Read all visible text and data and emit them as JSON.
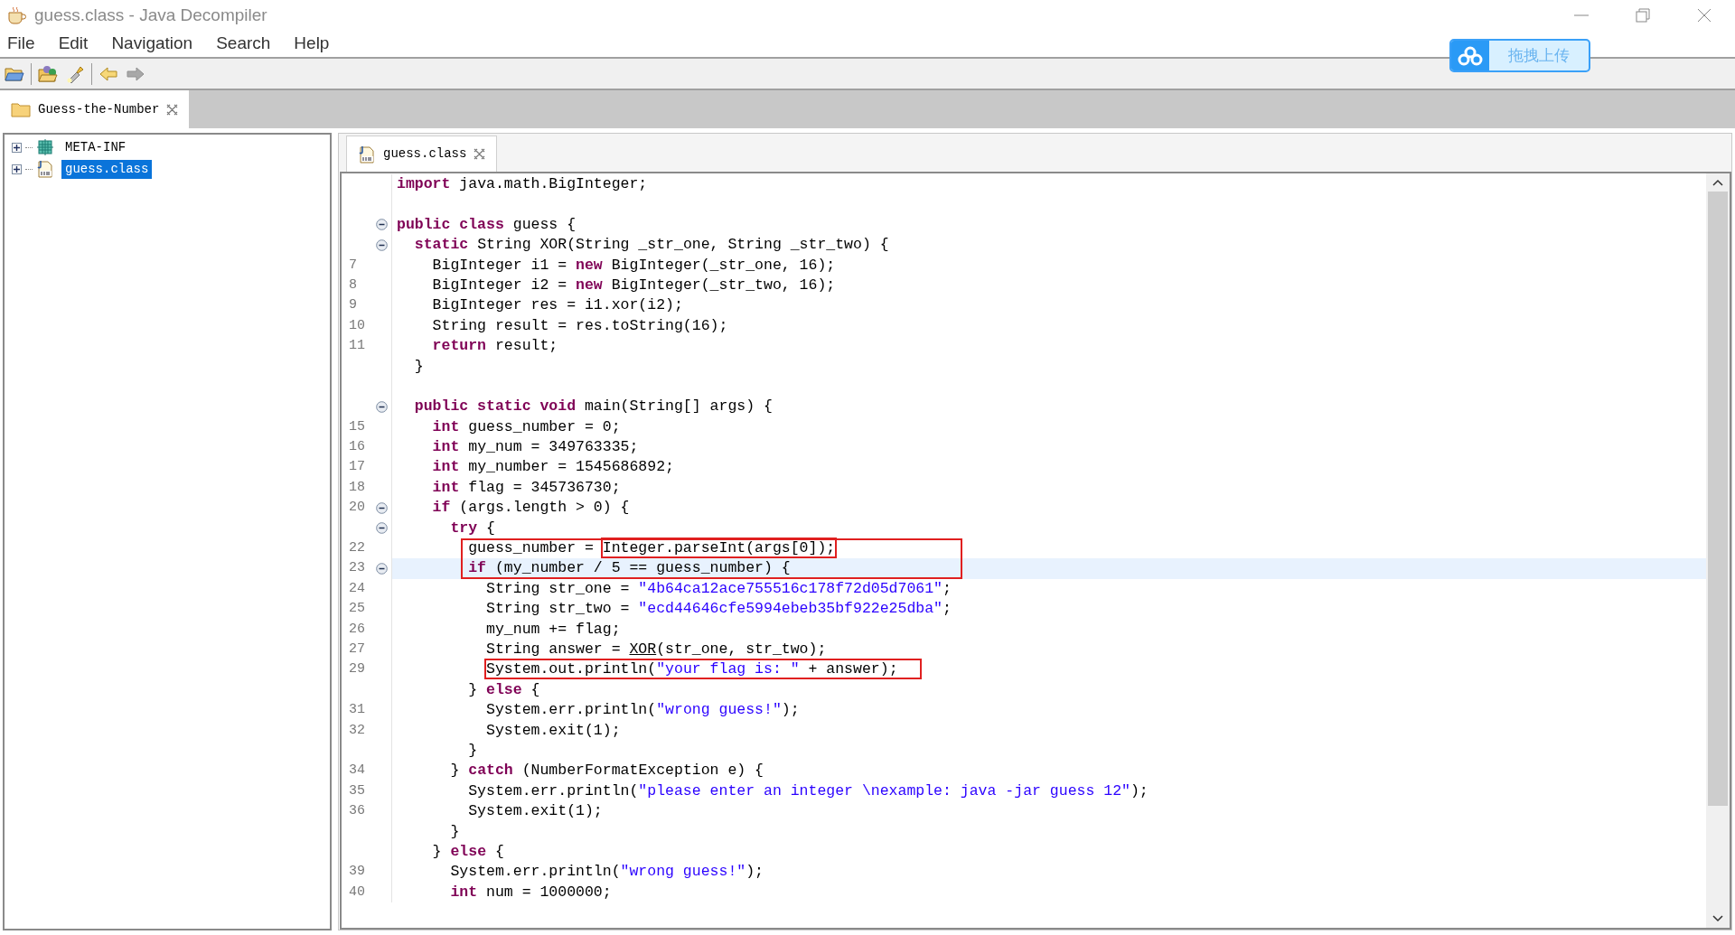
{
  "window": {
    "title": "guess.class - Java Decompiler"
  },
  "menu": [
    "File",
    "Edit",
    "Navigation",
    "Search",
    "Help"
  ],
  "toolbar": [
    {
      "kind": "open"
    },
    {
      "kind": "open-type"
    },
    {
      "kind": "search"
    },
    {
      "kind": "back",
      "disabled": false
    },
    {
      "kind": "forward",
      "disabled": true
    }
  ],
  "upload_button": {
    "label": "拖拽上传"
  },
  "project_tabs": [
    {
      "label": "Guess-the-Number",
      "selected": true
    }
  ],
  "tree": [
    {
      "label": "META-INF",
      "kind": "package",
      "expanded": false,
      "selected": false
    },
    {
      "label": "guess.class",
      "kind": "class",
      "expanded": false,
      "selected": true
    }
  ],
  "editor_tabs": [
    {
      "label": "guess.class",
      "selected": true
    }
  ],
  "code": {
    "lines": [
      {
        "tokens": [
          {
            "t": "import",
            "kind": "keyword"
          },
          {
            "t": " java.math.BigInteger;",
            "kind": "plain"
          }
        ]
      },
      {
        "kind": "blank"
      },
      {
        "fold": true,
        "tokens": [
          {
            "t": "public class",
            "kind": "keyword"
          },
          {
            "t": " guess {",
            "kind": "plain"
          }
        ]
      },
      {
        "fold": true,
        "tokens": [
          {
            "t": "  static",
            "kind": "keyword"
          },
          {
            "t": " String XOR(String _str_one, String _str_two) {",
            "kind": "plain"
          }
        ]
      },
      {
        "number": "7",
        "tokens": [
          {
            "t": "    BigInteger i1 = ",
            "kind": "plain"
          },
          {
            "t": "new",
            "kind": "keyword"
          },
          {
            "t": " BigInteger(_str_one, 16);",
            "kind": "plain"
          }
        ]
      },
      {
        "number": "8",
        "tokens": [
          {
            "t": "    BigInteger i2 = ",
            "kind": "plain"
          },
          {
            "t": "new",
            "kind": "keyword"
          },
          {
            "t": " BigInteger(_str_two, 16);",
            "kind": "plain"
          }
        ]
      },
      {
        "number": "9",
        "tokens": [
          {
            "t": "    BigInteger res = i1.xor(i2);",
            "kind": "plain"
          }
        ]
      },
      {
        "number": "10",
        "tokens": [
          {
            "t": "    String result = res.toString(16);",
            "kind": "plain"
          }
        ]
      },
      {
        "number": "11",
        "tokens": [
          {
            "t": "    return",
            "kind": "keyword"
          },
          {
            "t": " result;",
            "kind": "plain"
          }
        ]
      },
      {
        "tokens": [
          {
            "t": "  }",
            "kind": "plain"
          }
        ]
      },
      {
        "kind": "blank"
      },
      {
        "fold": true,
        "tokens": [
          {
            "t": "  public static void",
            "kind": "keyword"
          },
          {
            "t": " main(String[] args) {",
            "kind": "plain"
          }
        ]
      },
      {
        "number": "15",
        "tokens": [
          {
            "t": "    int",
            "kind": "keyword"
          },
          {
            "t": " guess_number = 0;",
            "kind": "plain"
          }
        ]
      },
      {
        "number": "16",
        "tokens": [
          {
            "t": "    int",
            "kind": "keyword"
          },
          {
            "t": " my_num = 349763335;",
            "kind": "plain"
          }
        ]
      },
      {
        "number": "17",
        "tokens": [
          {
            "t": "    int",
            "kind": "keyword"
          },
          {
            "t": " my_number = 1545686892;",
            "kind": "plain"
          }
        ]
      },
      {
        "number": "18",
        "tokens": [
          {
            "t": "    int",
            "kind": "keyword"
          },
          {
            "t": " flag = 345736730;",
            "kind": "plain"
          }
        ]
      },
      {
        "number": "20",
        "fold": true,
        "tokens": [
          {
            "t": "    if",
            "kind": "keyword"
          },
          {
            "t": " (args.length > 0) {",
            "kind": "plain"
          }
        ]
      },
      {
        "fold": true,
        "tokens": [
          {
            "t": "      try",
            "kind": "keyword"
          },
          {
            "t": " {",
            "kind": "plain"
          }
        ]
      },
      {
        "number": "22",
        "framed": true,
        "tokens": [
          {
            "t": "        guess_number = ",
            "kind": "plain"
          },
          {
            "t": "Integer.parseInt(args[0]);",
            "kind": "plain",
            "boxed": true
          }
        ]
      },
      {
        "number": "23",
        "fold": true,
        "highlighted": true,
        "framed": true,
        "tokens": [
          {
            "t": "        if",
            "kind": "keyword"
          },
          {
            "t": " (my_number / 5 == guess_number) {",
            "kind": "plain"
          }
        ]
      },
      {
        "number": "24",
        "tokens": [
          {
            "t": "          String str_one = ",
            "kind": "plain"
          },
          {
            "t": "\"4b64ca12ace755516c178f72d05d7061\"",
            "kind": "string"
          },
          {
            "t": ";",
            "kind": "plain"
          }
        ]
      },
      {
        "number": "25",
        "tokens": [
          {
            "t": "          String str_two = ",
            "kind": "plain"
          },
          {
            "t": "\"ecd44646cfe5994ebeb35bf922e25dba\"",
            "kind": "string"
          },
          {
            "t": ";",
            "kind": "plain"
          }
        ]
      },
      {
        "number": "26",
        "tokens": [
          {
            "t": "          my_num += flag;",
            "kind": "plain"
          }
        ]
      },
      {
        "number": "27",
        "tokens": [
          {
            "t": "          String answer = ",
            "kind": "plain"
          },
          {
            "t": "XOR",
            "kind": "plain",
            "underline": true
          },
          {
            "t": "(str_one, str_two);",
            "kind": "plain"
          }
        ]
      },
      {
        "number": "29",
        "boxed": true,
        "tokens": [
          {
            "t": "          System.out.println(",
            "kind": "plain"
          },
          {
            "t": "\"your flag is: \"",
            "kind": "string"
          },
          {
            "t": " + answer);",
            "kind": "plain"
          }
        ]
      },
      {
        "tokens": [
          {
            "t": "        } ",
            "kind": "plain"
          },
          {
            "t": "else",
            "kind": "keyword"
          },
          {
            "t": " {",
            "kind": "plain"
          }
        ]
      },
      {
        "number": "31",
        "tokens": [
          {
            "t": "          System.err.println(",
            "kind": "plain"
          },
          {
            "t": "\"wrong guess!\"",
            "kind": "string"
          },
          {
            "t": ");",
            "kind": "plain"
          }
        ]
      },
      {
        "number": "32",
        "tokens": [
          {
            "t": "          System.exit(1);",
            "kind": "plain"
          }
        ]
      },
      {
        "tokens": [
          {
            "t": "        }",
            "kind": "plain"
          }
        ]
      },
      {
        "number": "34",
        "tokens": [
          {
            "t": "      } ",
            "kind": "plain"
          },
          {
            "t": "catch",
            "kind": "keyword"
          },
          {
            "t": " (NumberFormatException e) {",
            "kind": "plain"
          }
        ]
      },
      {
        "number": "35",
        "tokens": [
          {
            "t": "        System.err.println(",
            "kind": "plain"
          },
          {
            "t": "\"please enter an integer \\nexample: java -jar guess 12\"",
            "kind": "string"
          },
          {
            "t": ");",
            "kind": "plain"
          }
        ]
      },
      {
        "number": "36",
        "tokens": [
          {
            "t": "        System.exit(1);",
            "kind": "plain"
          }
        ]
      },
      {
        "tokens": [
          {
            "t": "      }",
            "kind": "plain"
          }
        ]
      },
      {
        "tokens": [
          {
            "t": "    } ",
            "kind": "plain"
          },
          {
            "t": "else",
            "kind": "keyword"
          },
          {
            "t": " {",
            "kind": "plain"
          }
        ]
      },
      {
        "number": "39",
        "tokens": [
          {
            "t": "      System.err.println(",
            "kind": "plain"
          },
          {
            "t": "\"wrong guess!\"",
            "kind": "string"
          },
          {
            "t": ");",
            "kind": "plain"
          }
        ]
      },
      {
        "number": "40",
        "tokens": [
          {
            "t": "      int",
            "kind": "keyword"
          },
          {
            "t": " num = 1000000;",
            "kind": "plain"
          }
        ]
      }
    ]
  }
}
